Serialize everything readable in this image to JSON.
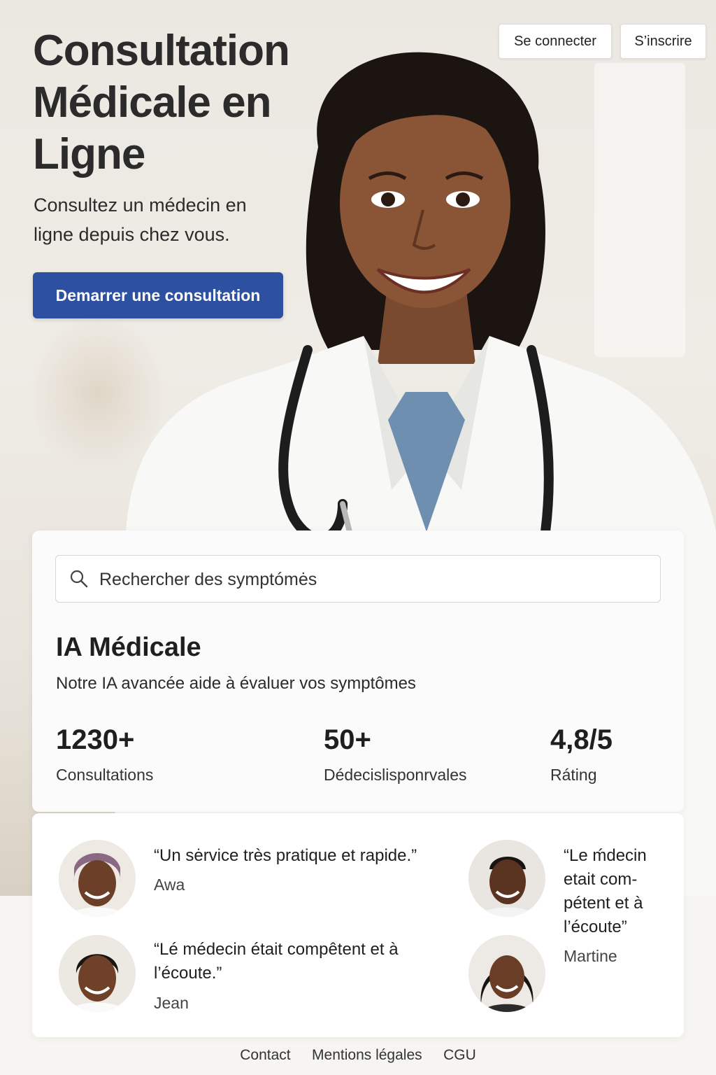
{
  "header": {
    "title": "Consultation Médicale en Ligne",
    "subtitle": "Consultez un médecin en ligne depuis chez vous.",
    "cta_label": "Demarrer une consultation",
    "login_label": "Se connecter",
    "signup_label": "S’inscrire"
  },
  "search": {
    "placeholder": "Rechercher des symptómės"
  },
  "ai": {
    "title": "IA Médicale",
    "description": "Notre IA avancée aide à évaluer vos symptômes"
  },
  "stats": [
    {
      "value": "1230+",
      "label": "Consultations"
    },
    {
      "value": "50+",
      "label": "Dédecislisponrvales"
    },
    {
      "value": "4,8/5",
      "label": "Ráting"
    }
  ],
  "testimonials": [
    {
      "quote": "“Un sėrvice très pratique et rapide.”",
      "author": "Awa"
    },
    {
      "quote": "“Lé médecin était compêtent et à l’écoute.”",
      "author": "Jean"
    },
    {
      "quote": "“Le ḿdecin etait com- pétent et à l’écoute”",
      "author": "Martine"
    }
  ],
  "footer": {
    "links": [
      "Contact",
      "Mentions légales",
      "CGU"
    ]
  },
  "colors": {
    "accent": "#2d50a0",
    "text": "#2b2b2b",
    "background": "#f6f5f2"
  },
  "icons": {
    "search": "search-icon"
  }
}
